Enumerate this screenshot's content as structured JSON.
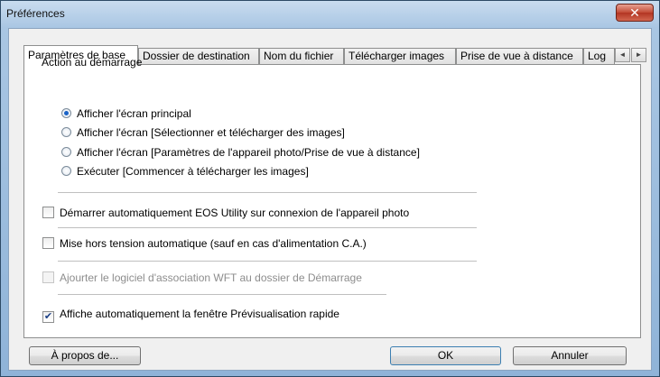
{
  "window": {
    "title": "Préférences"
  },
  "tabs": [
    {
      "label": "Paramètres de base"
    },
    {
      "label": "Dossier de destination"
    },
    {
      "label": "Nom du fichier"
    },
    {
      "label": "Télécharger images"
    },
    {
      "label": "Prise de vue à distance"
    },
    {
      "label": "Log"
    }
  ],
  "startup": {
    "title": "Action au démarrage",
    "options": [
      {
        "label": "Afficher l'écran principal",
        "checked": true
      },
      {
        "label": "Afficher l'écran [Sélectionner et télécharger des images]",
        "checked": false
      },
      {
        "label": "Afficher l'écran [Paramètres de l'appareil photo/Prise de vue à distance]",
        "checked": false
      },
      {
        "label": "Exécuter [Commencer à télécharger les images]",
        "checked": false
      }
    ]
  },
  "checkboxes": [
    {
      "label": "Démarrer automatiquement EOS Utility sur connexion de l'appareil photo",
      "checked": false,
      "enabled": true
    },
    {
      "label": "Mise hors tension automatique (sauf en cas d'alimentation C.A.)",
      "checked": false,
      "enabled": true
    },
    {
      "label": "Ajourter le logiciel d'association WFT au dossier de Démarrage",
      "checked": false,
      "enabled": false
    },
    {
      "label": "Affiche automatiquement la fenêtre Prévisualisation rapide",
      "checked": true,
      "enabled": true
    }
  ],
  "buttons": {
    "about": "À propos de...",
    "ok": "OK",
    "cancel": "Annuler"
  },
  "icons": {
    "close": "close-icon",
    "scroll_left": "scroll-left-icon",
    "scroll_right": "scroll-right-icon"
  }
}
